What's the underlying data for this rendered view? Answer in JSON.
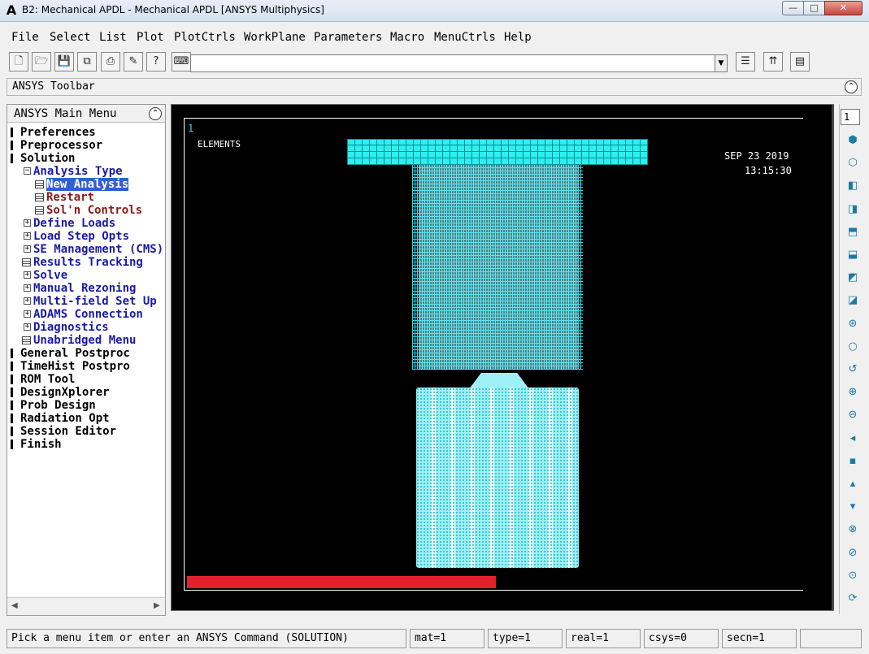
{
  "window": {
    "title": "B2: Mechanical APDL - Mechanical APDL [ANSYS Multiphysics]",
    "logo_text": "A",
    "min_glyph": "—",
    "max_glyph": "□",
    "close_glyph": "✕"
  },
  "menubar": [
    "File",
    "Select",
    "List",
    "Plot",
    "PlotCtrls",
    "WorkPlane",
    "Parameters",
    "Macro",
    "MenuCtrls",
    "Help"
  ],
  "toolbar": {
    "buttons": [
      "new-file",
      "open-file",
      "save",
      "save-db",
      "print",
      "report",
      "help"
    ],
    "command_value": "",
    "command_dropdown": "▼"
  },
  "ansys_toolbar": {
    "label": "ANSYS Toolbar",
    "collapse_glyph": "⌃"
  },
  "main_menu": {
    "title": "ANSYS Main Menu",
    "collapse_glyph": "⌃",
    "items": [
      {
        "label": "Preferences",
        "level": 0,
        "marker": "bar",
        "color": "black"
      },
      {
        "label": "Preprocessor",
        "level": 0,
        "marker": "bar",
        "color": "black"
      },
      {
        "label": "Solution",
        "level": 0,
        "marker": "bar",
        "color": "black"
      },
      {
        "label": "Analysis Type",
        "level": 1,
        "marker": "minus",
        "color": "blue"
      },
      {
        "label": "New Analysis",
        "level": 2,
        "marker": "doc",
        "color": "blue",
        "selected": true
      },
      {
        "label": "Restart",
        "level": 2,
        "marker": "doc",
        "color": "red"
      },
      {
        "label": "Sol'n Controls",
        "level": 2,
        "marker": "doc",
        "color": "red"
      },
      {
        "label": "Define Loads",
        "level": 1,
        "marker": "plus",
        "color": "blue"
      },
      {
        "label": "Load Step Opts",
        "level": 1,
        "marker": "plus",
        "color": "blue"
      },
      {
        "label": "SE Management (CMS)",
        "level": 1,
        "marker": "plus",
        "color": "blue"
      },
      {
        "label": "Results Tracking",
        "level": 1,
        "marker": "doc",
        "color": "blue"
      },
      {
        "label": "Solve",
        "level": 1,
        "marker": "plus",
        "color": "blue"
      },
      {
        "label": "Manual Rezoning",
        "level": 1,
        "marker": "plus",
        "color": "blue"
      },
      {
        "label": "Multi-field Set Up",
        "level": 1,
        "marker": "plus",
        "color": "blue"
      },
      {
        "label": "ADAMS Connection",
        "level": 1,
        "marker": "plus",
        "color": "blue"
      },
      {
        "label": "Diagnostics",
        "level": 1,
        "marker": "plus",
        "color": "blue"
      },
      {
        "label": "Unabridged Menu",
        "level": 1,
        "marker": "doc",
        "color": "blue"
      },
      {
        "label": "General Postproc",
        "level": 0,
        "marker": "bar",
        "color": "black"
      },
      {
        "label": "TimeHist Postpro",
        "level": 0,
        "marker": "bar",
        "color": "black"
      },
      {
        "label": "ROM Tool",
        "level": 0,
        "marker": "bar",
        "color": "black"
      },
      {
        "label": "DesignXplorer",
        "level": 0,
        "marker": "bar",
        "color": "black"
      },
      {
        "label": "Prob Design",
        "level": 0,
        "marker": "bar",
        "color": "black"
      },
      {
        "label": "Radiation Opt",
        "level": 0,
        "marker": "bar",
        "color": "black"
      },
      {
        "label": "Session Editor",
        "level": 0,
        "marker": "bar",
        "color": "black"
      },
      {
        "label": "Finish",
        "level": 0,
        "marker": "bar",
        "color": "black"
      }
    ],
    "scroll_left": "◀",
    "scroll_right": "▶"
  },
  "graphics": {
    "window_number": "1",
    "plot_label": "ELEMENTS",
    "date": "SEP 23 2019",
    "time": "13:15:30",
    "colors": {
      "background": "#000000",
      "mesh": "#2cf0f0",
      "progress": "#e4202a"
    },
    "progress_fraction": 0.5
  },
  "view_toolbar": {
    "window_select": "1",
    "icons": [
      {
        "name": "iso-view-icon",
        "glyph": "⬢"
      },
      {
        "name": "oblique-view-icon",
        "glyph": "⬡"
      },
      {
        "name": "front-view-icon",
        "glyph": "◧"
      },
      {
        "name": "back-view-icon",
        "glyph": "◨"
      },
      {
        "name": "top-view-icon",
        "glyph": "⬒"
      },
      {
        "name": "bottom-view-icon",
        "glyph": "⬓"
      },
      {
        "name": "left-view-icon",
        "glyph": "◩"
      },
      {
        "name": "right-view-icon",
        "glyph": "◪"
      },
      {
        "name": "fit-view-icon",
        "glyph": "⊛"
      },
      {
        "name": "zoom-icon",
        "glyph": "○"
      },
      {
        "name": "zoom-back-icon",
        "glyph": "↺"
      },
      {
        "name": "zoom-in-icon",
        "glyph": "⊕"
      },
      {
        "name": "zoom-out-icon",
        "glyph": "⊖"
      },
      {
        "name": "pan-left-icon",
        "glyph": "◂"
      },
      {
        "name": "pan-center-icon",
        "glyph": "▪"
      },
      {
        "name": "pan-up-icon",
        "glyph": "▴"
      },
      {
        "name": "pan-down-icon",
        "glyph": "▾"
      },
      {
        "name": "rotate-x-icon",
        "glyph": "⊗"
      },
      {
        "name": "rotate-y-icon",
        "glyph": "⊘"
      },
      {
        "name": "rotate-z-icon",
        "glyph": "⊙"
      },
      {
        "name": "rotate-more-icon",
        "glyph": "⟳"
      }
    ]
  },
  "status": {
    "prompt": "Pick a menu item or enter an ANSYS Command (SOLUTION)",
    "mat": "mat=1",
    "type": "type=1",
    "real": "real=1",
    "csys": "csys=0",
    "secn": "secn=1",
    "extra": ""
  }
}
